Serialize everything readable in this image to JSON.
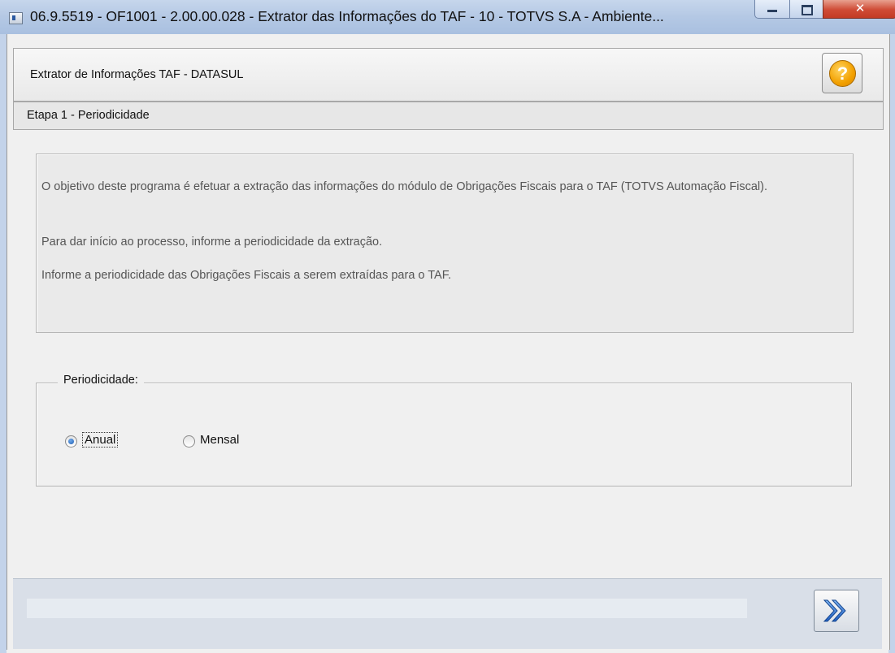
{
  "window": {
    "title": "06.9.5519 - OF1001 - 2.00.00.028 - Extrator das Informações do TAF - 10 - TOTVS S.A - Ambiente...",
    "controls": [
      "minimize-icon",
      "maximize-icon",
      "close-icon"
    ]
  },
  "header": {
    "title": "Extrator de Informações TAF - DATASUL",
    "help_icon": "help-icon",
    "help_glyph": "?"
  },
  "step": {
    "title": "Etapa 1 - Periodicidade"
  },
  "intro": {
    "paragraphs": [
      "O objetivo deste programa é efetuar a extração das informações do módulo de Obrigações Fiscais para o TAF (TOTVS Automação Fiscal).",
      "Para dar início ao processo, informe a periodicidade da extração.",
      "Informe a periodicidade das Obrigações Fiscais a serem extraídas para o TAF."
    ]
  },
  "periodicity": {
    "legend": "Periodicidade:",
    "options": [
      {
        "label": "Anual",
        "selected": true
      },
      {
        "label": "Mensal",
        "selected": false
      }
    ]
  },
  "footer": {
    "status_text": "",
    "next_icon": "next-icon"
  },
  "colors": {
    "titlebar": "#b4c8e4",
    "window_bg": "#f0f0f0",
    "footer_bg": "#d9dfe8",
    "help_orange": "#f2a000",
    "next_blue": "#2a6fd6"
  }
}
